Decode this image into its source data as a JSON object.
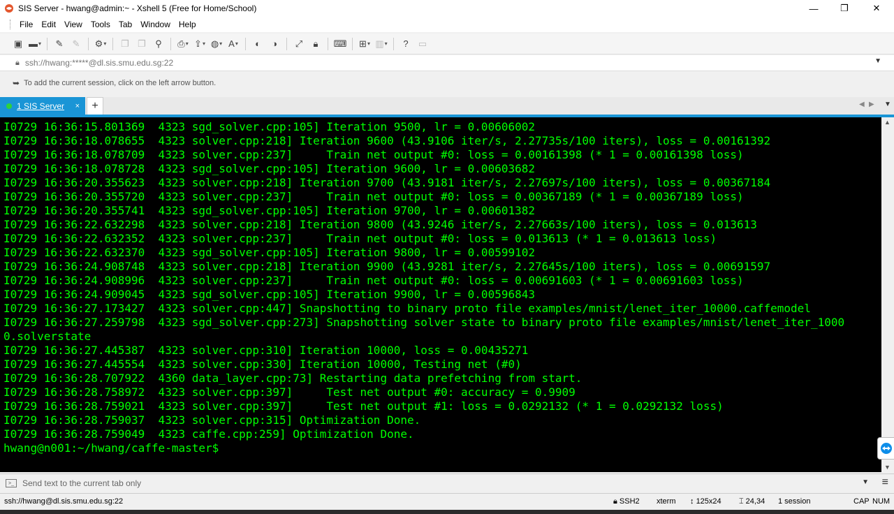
{
  "window": {
    "title": "SIS Server - hwang@admin:~ - Xshell 5 (Free for Home/School)",
    "controls": {
      "minimize": "—",
      "maximize": "❐",
      "close": "✕"
    }
  },
  "menu": [
    "File",
    "Edit",
    "View",
    "Tools",
    "Tab",
    "Window",
    "Help"
  ],
  "address": {
    "url": "ssh://hwang:*****@dl.sis.smu.edu.sg:22"
  },
  "hint": {
    "text": "To add the current session, click on the left arrow button."
  },
  "tabs": {
    "active_label": "1 SIS Server",
    "close": "×",
    "add": "+"
  },
  "terminal": {
    "color": "#00ff00",
    "lines": [
      "I0729 16:36:15.801369  4323 sgd_solver.cpp:105] Iteration 9500, lr = 0.00606002",
      "I0729 16:36:18.078655  4323 solver.cpp:218] Iteration 9600 (43.9106 iter/s, 2.27735s/100 iters), loss = 0.00161392",
      "I0729 16:36:18.078709  4323 solver.cpp:237]     Train net output #0: loss = 0.00161398 (* 1 = 0.00161398 loss)",
      "I0729 16:36:18.078728  4323 sgd_solver.cpp:105] Iteration 9600, lr = 0.00603682",
      "I0729 16:36:20.355623  4323 solver.cpp:218] Iteration 9700 (43.9181 iter/s, 2.27697s/100 iters), loss = 0.00367184",
      "I0729 16:36:20.355720  4323 solver.cpp:237]     Train net output #0: loss = 0.00367189 (* 1 = 0.00367189 loss)",
      "I0729 16:36:20.355741  4323 sgd_solver.cpp:105] Iteration 9700, lr = 0.00601382",
      "I0729 16:36:22.632298  4323 solver.cpp:218] Iteration 9800 (43.9246 iter/s, 2.27663s/100 iters), loss = 0.013613",
      "I0729 16:36:22.632352  4323 solver.cpp:237]     Train net output #0: loss = 0.013613 (* 1 = 0.013613 loss)",
      "I0729 16:36:22.632370  4323 sgd_solver.cpp:105] Iteration 9800, lr = 0.00599102",
      "I0729 16:36:24.908748  4323 solver.cpp:218] Iteration 9900 (43.9281 iter/s, 2.27645s/100 iters), loss = 0.00691597",
      "I0729 16:36:24.908996  4323 solver.cpp:237]     Train net output #0: loss = 0.00691603 (* 1 = 0.00691603 loss)",
      "I0729 16:36:24.909045  4323 sgd_solver.cpp:105] Iteration 9900, lr = 0.00596843",
      "I0729 16:36:27.173427  4323 solver.cpp:447] Snapshotting to binary proto file examples/mnist/lenet_iter_10000.caffemodel",
      "I0729 16:36:27.259798  4323 sgd_solver.cpp:273] Snapshotting solver state to binary proto file examples/mnist/lenet_iter_1000",
      "0.solverstate",
      "I0729 16:36:27.445387  4323 solver.cpp:310] Iteration 10000, loss = 0.00435271",
      "I0729 16:36:27.445554  4323 solver.cpp:330] Iteration 10000, Testing net (#0)",
      "I0729 16:36:28.707922  4360 data_layer.cpp:73] Restarting data prefetching from start.",
      "I0729 16:36:28.758972  4323 solver.cpp:397]     Test net output #0: accuracy = 0.9909",
      "I0729 16:36:28.759021  4323 solver.cpp:397]     Test net output #1: loss = 0.0292132 (* 1 = 0.0292132 loss)",
      "I0729 16:36:28.759037  4323 solver.cpp:315] Optimization Done.",
      "I0729 16:36:28.759049  4323 caffe.cpp:259] Optimization Done.",
      "hwang@n001:~/hwang/caffe-master$"
    ]
  },
  "sendbar": {
    "text": "Send text to the current tab only"
  },
  "status": {
    "connection": "ssh://hwang@dl.sis.smu.edu.sg:22",
    "protocol": "SSH2",
    "terminal_type": "xterm",
    "size": "125x24",
    "cursor": "24,34",
    "sessions": "1 session",
    "caps": "CAP",
    "num": "NUM"
  }
}
